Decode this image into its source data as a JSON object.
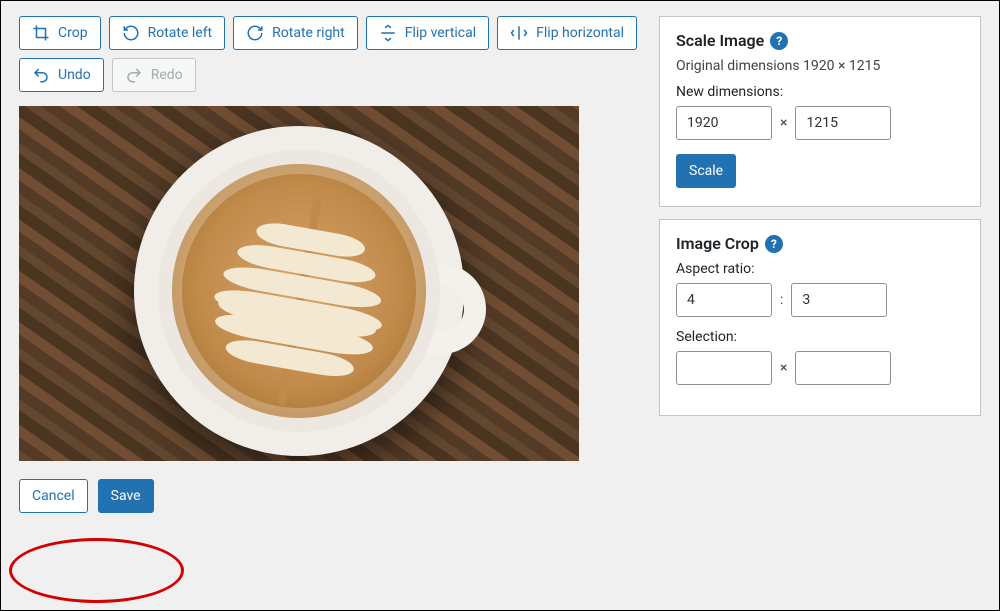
{
  "toolbar": {
    "crop": "Crop",
    "rotate_left": "Rotate left",
    "rotate_right": "Rotate right",
    "flip_vertical": "Flip vertical",
    "flip_horizontal": "Flip horizontal",
    "undo": "Undo",
    "redo": "Redo"
  },
  "actions": {
    "cancel": "Cancel",
    "save": "Save"
  },
  "scale": {
    "title": "Scale Image",
    "original_label": "Original dimensions 1920 × 1215",
    "new_label": "New dimensions:",
    "width": "1920",
    "height": "1215",
    "sep": "×",
    "button": "Scale"
  },
  "crop_panel": {
    "title": "Image Crop",
    "aspect_label": "Aspect ratio:",
    "aspect_w": "4",
    "aspect_h": "3",
    "aspect_sep": ":",
    "selection_label": "Selection:",
    "sel_w": "",
    "sel_h": "",
    "sel_sep": "×"
  },
  "help_glyph": "?"
}
